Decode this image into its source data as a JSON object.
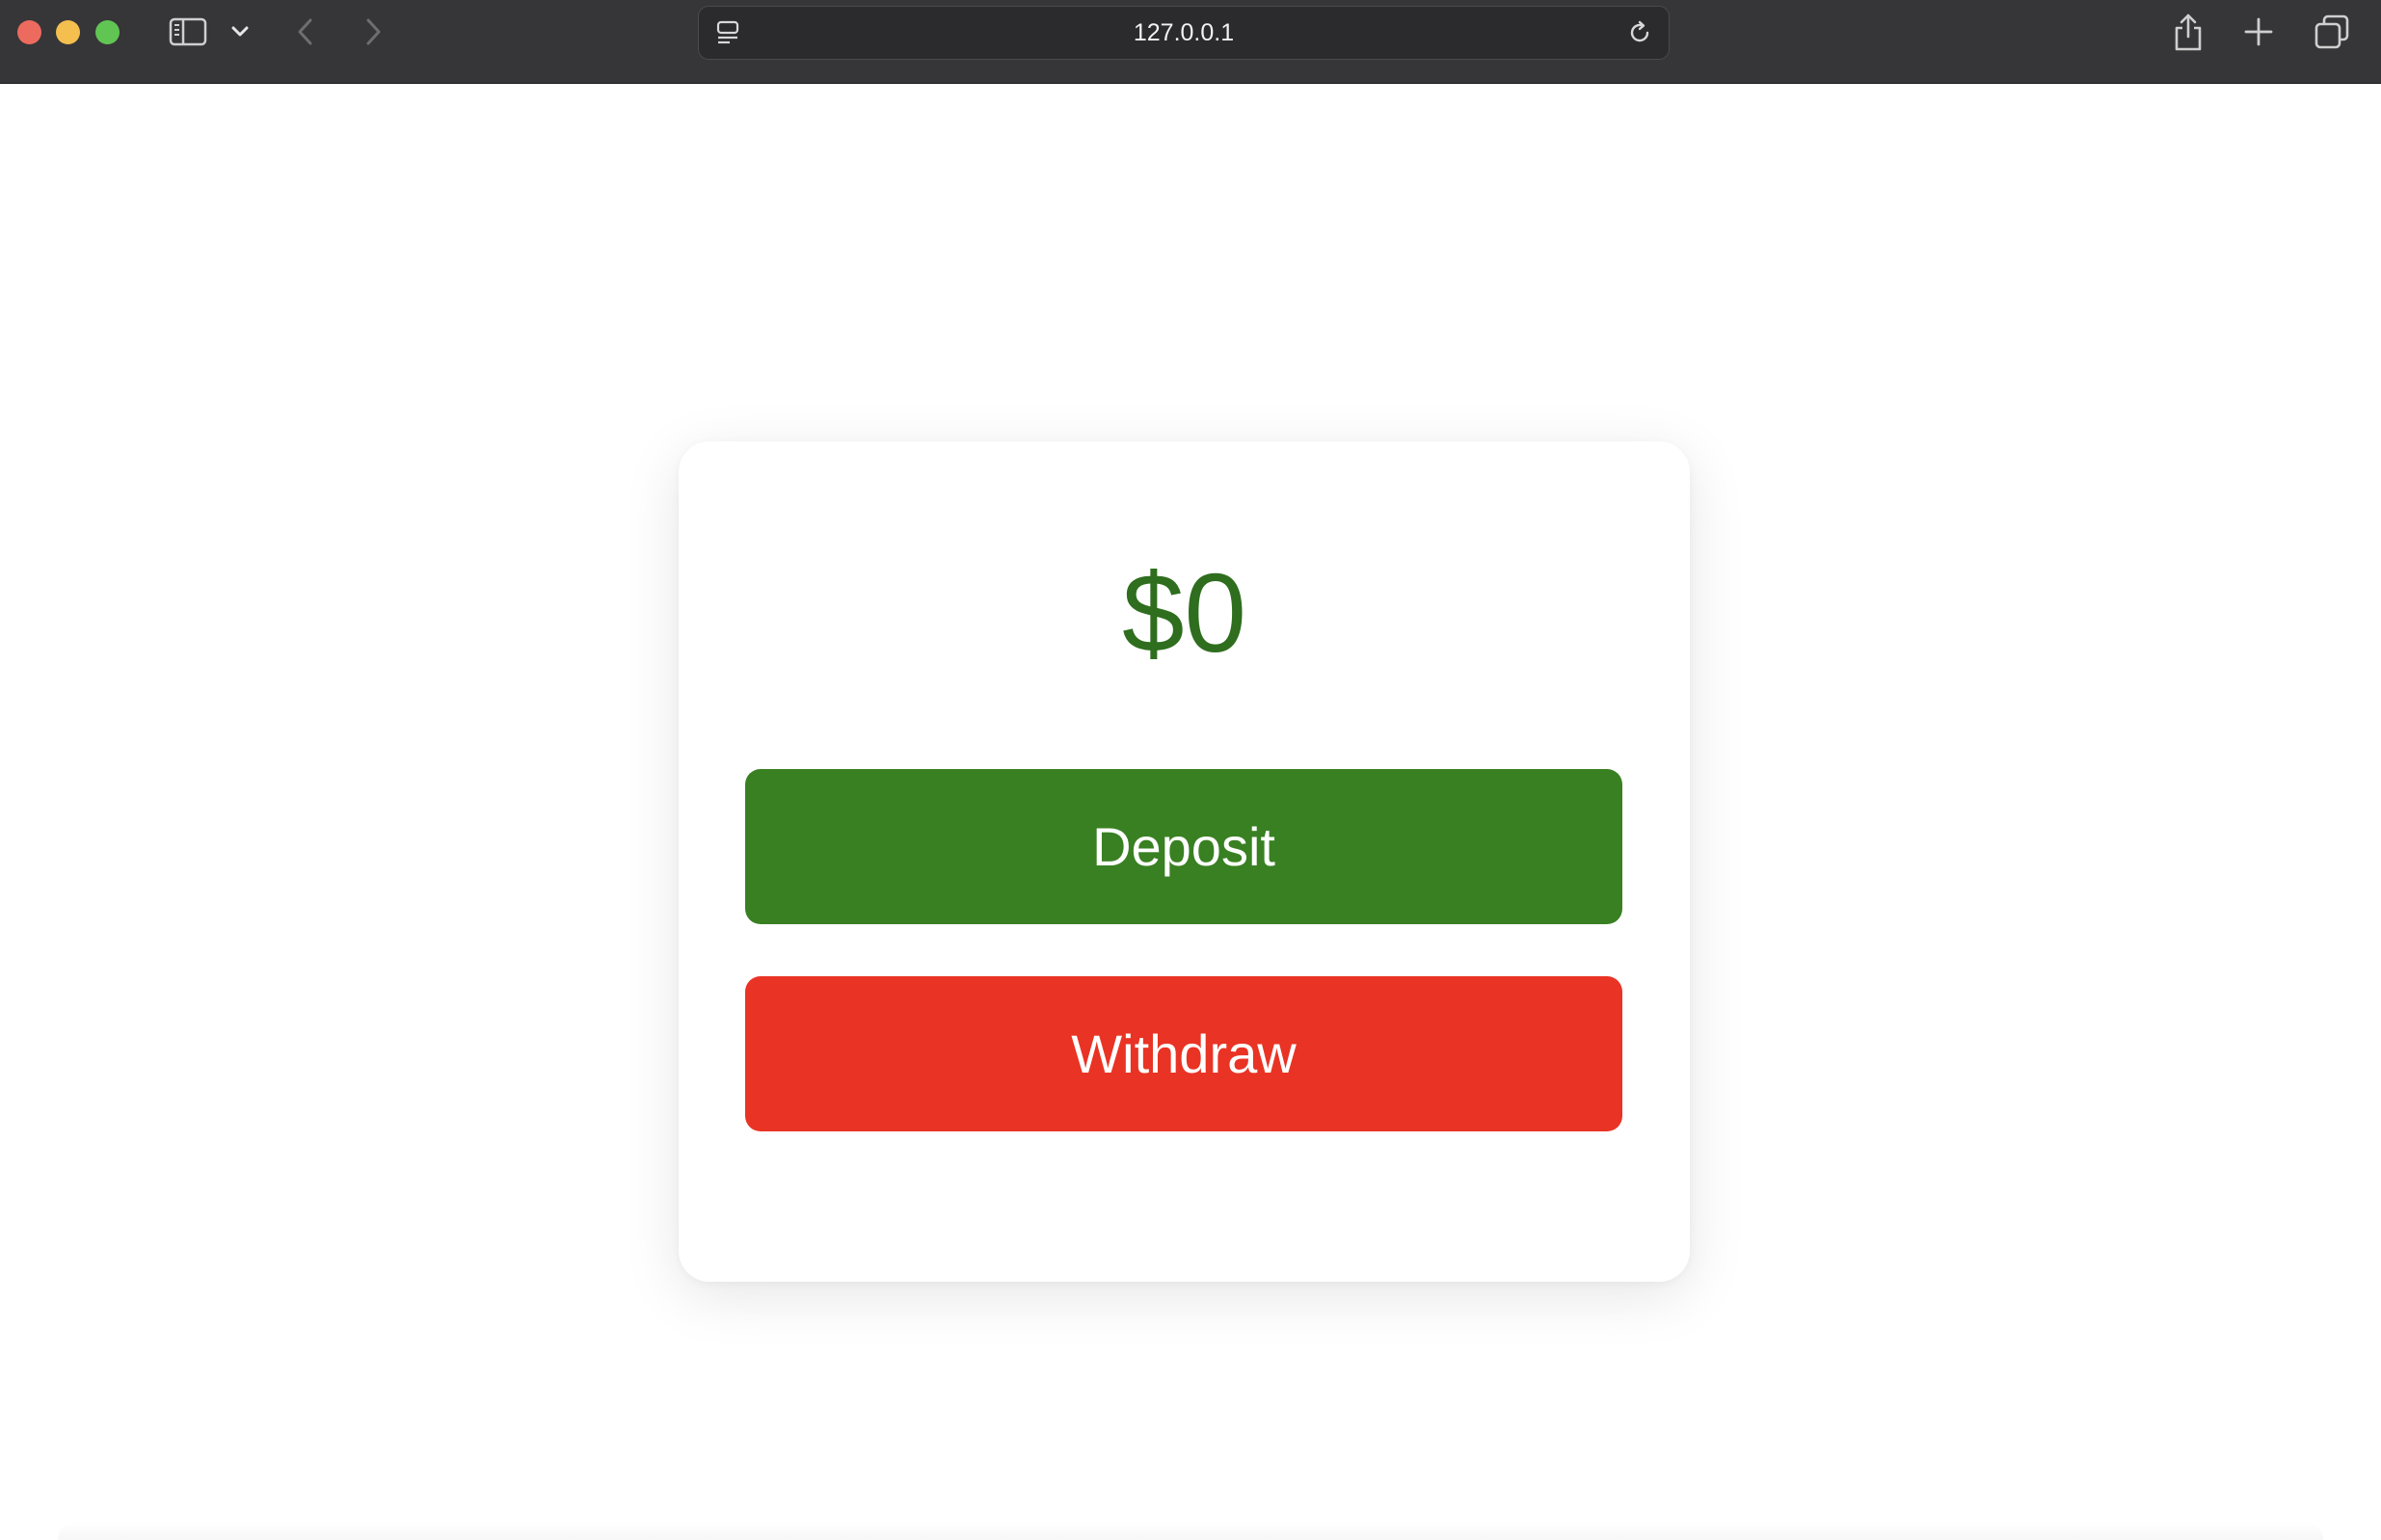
{
  "browser": {
    "url": "127.0.0.1",
    "icons": {
      "sidebar": "sidebar-icon",
      "chevron": "chevron-down-icon",
      "back": "back-arrow-icon",
      "forward": "forward-arrow-icon",
      "page": "page-menu-icon",
      "reload": "reload-icon",
      "share": "share-icon",
      "new_tab": "plus-icon",
      "tab_overview": "tab-overview-icon"
    }
  },
  "account": {
    "balance": "$0",
    "deposit_label": "Deposit",
    "withdraw_label": "Withdraw"
  },
  "colors": {
    "balance_text": "#2e6e1e",
    "deposit_bg": "#398022",
    "withdraw_bg": "#e93324",
    "toolbar_bg": "#363638"
  }
}
